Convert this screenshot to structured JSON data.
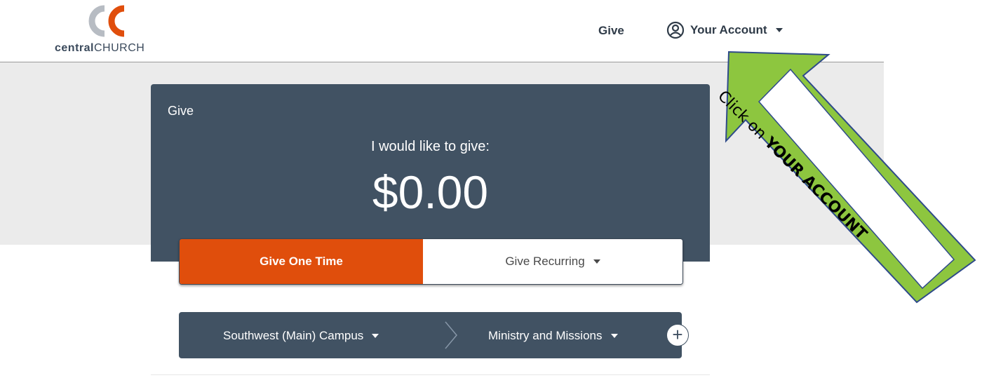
{
  "logo": {
    "brand_bold": "central",
    "brand_light": "CHURCH"
  },
  "nav": {
    "give": "Give",
    "account": "Your Account"
  },
  "card": {
    "title": "Give",
    "subtitle": "I would like to give:",
    "amount": "$0.00"
  },
  "tabs": {
    "one_time": "Give One Time",
    "recurring": "Give Recurring"
  },
  "fund": {
    "campus": "Southwest (Main) Campus",
    "ministry": "Ministry and Missions",
    "add": "+"
  },
  "callout": {
    "prefix": "Click on ",
    "emphasis": "YOUR ACCOUNT"
  },
  "colors": {
    "header_text": "#2f3b48",
    "card_dark": "#415263",
    "accent_orange": "#e04e0c",
    "logo_grey": "#b7bcc3",
    "arrow_green": "#8dc63f",
    "arrow_border": "#2e4a8a"
  },
  "icons": {
    "account": "user-circle-icon",
    "caret": "caret-down-icon",
    "separator": "chevron-right-icon",
    "add": "plus-icon"
  }
}
